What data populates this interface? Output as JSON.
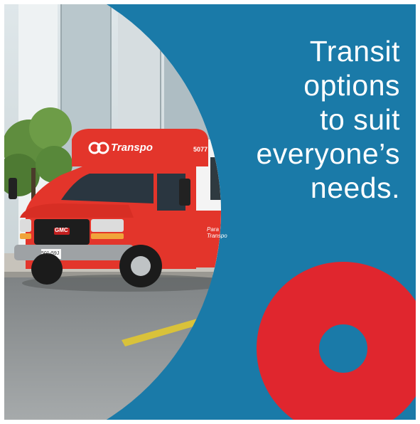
{
  "headline": {
    "lines": [
      "Transit",
      "options",
      "to suit",
      "everyone’s",
      "needs."
    ]
  },
  "bus": {
    "roof_sign": "Transpo",
    "side_label": "Para Transpo",
    "unit_number": "5077",
    "grille_badge": "GMC",
    "plate": "501-59J"
  },
  "colors": {
    "background": "#1a7aa8",
    "ring": "#e0262e",
    "bus": "#e3352b",
    "text": "#ffffff"
  }
}
